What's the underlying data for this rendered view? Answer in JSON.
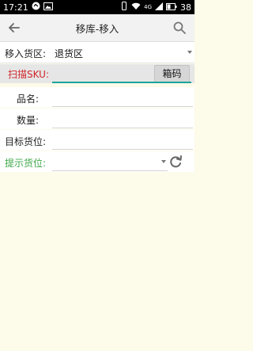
{
  "statusbar": {
    "time": "17:21",
    "battery": "38",
    "network": "4G"
  },
  "appbar": {
    "title": "移库-移入"
  },
  "form": {
    "zone_label": "移入货区:",
    "zone_value": "退货区",
    "sku_label": "扫描SKU:",
    "sku_value": "",
    "box_button": "箱码",
    "name_label": "品名:",
    "qty_label": "数量:",
    "target_label": "目标货位:",
    "hint_label": "提示货位:"
  },
  "colors": {
    "accent_teal": "#1ba39c",
    "error_red": "#d0262a",
    "hint_green": "#3fa84a",
    "background": "#fdfbe9"
  },
  "icons": {
    "back": "arrow-left-icon",
    "search": "search-icon",
    "refresh": "refresh-icon",
    "dropdown": "dropdown-caret-icon"
  }
}
